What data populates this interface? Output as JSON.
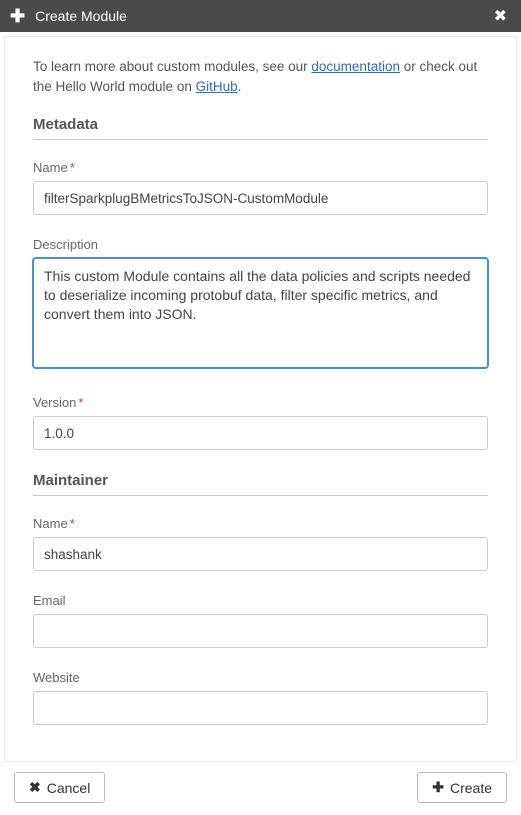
{
  "header": {
    "title": "Create Module"
  },
  "intro": {
    "prefix": "To learn more about custom modules, see our ",
    "doc_link": "documentation",
    "middle": " or check out the Hello World module on ",
    "github_link": "GitHub",
    "suffix": "."
  },
  "sections": {
    "metadata": "Metadata",
    "maintainer": "Maintainer"
  },
  "fields": {
    "name": {
      "label": "Name",
      "value": "filterSparkplugBMetricsToJSON-CustomModule"
    },
    "description": {
      "label": "Description",
      "value": "This custom Module contains all the data policies and scripts needed to deserialize incoming protobuf data, filter specific metrics, and convert them into JSON."
    },
    "version": {
      "label": "Version",
      "value": "1.0.0"
    },
    "maintainer_name": {
      "label": "Name",
      "value": "shashank"
    },
    "email": {
      "label": "Email",
      "value": ""
    },
    "website": {
      "label": "Website",
      "value": ""
    }
  },
  "buttons": {
    "cancel": "Cancel",
    "create": "Create"
  }
}
